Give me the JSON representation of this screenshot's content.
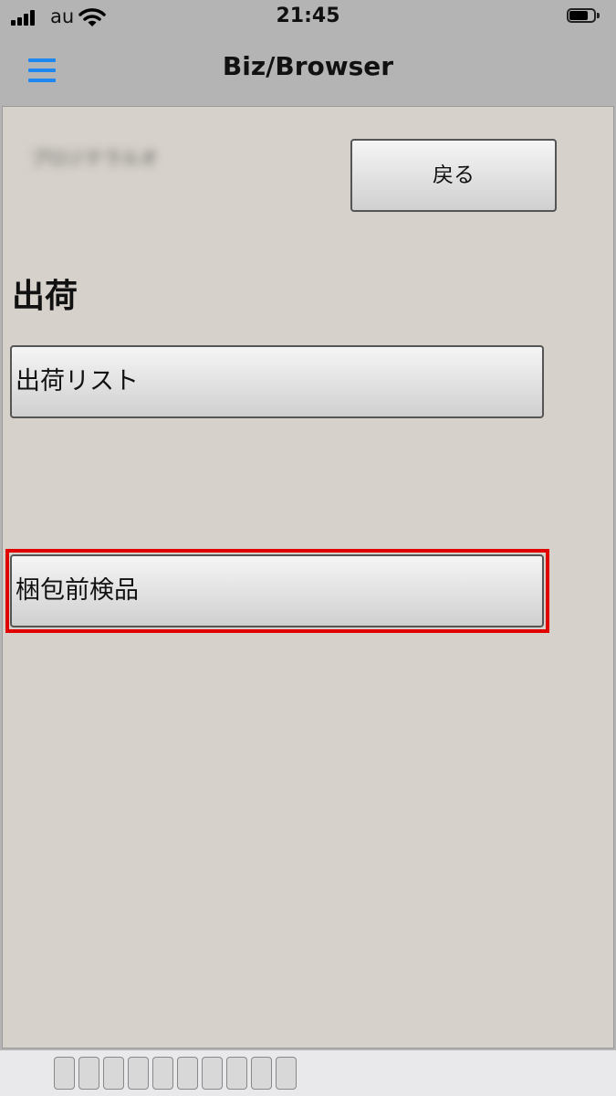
{
  "status": {
    "carrier": "au",
    "time": "21:45",
    "battery_level": 0.75
  },
  "nav": {
    "title": "Biz/Browser"
  },
  "content": {
    "user_name_blurred": "プロジテラルオ",
    "back_label": "戻る",
    "section_title": "出荷",
    "ship_list_label": "出荷リスト",
    "pre_pack_inspection_label": "梱包前検品"
  },
  "colors": {
    "accent": "#1e88f0",
    "highlight": "#e00000",
    "content_bg": "#d6d1ca",
    "nav_bg": "#b4b4b4"
  }
}
